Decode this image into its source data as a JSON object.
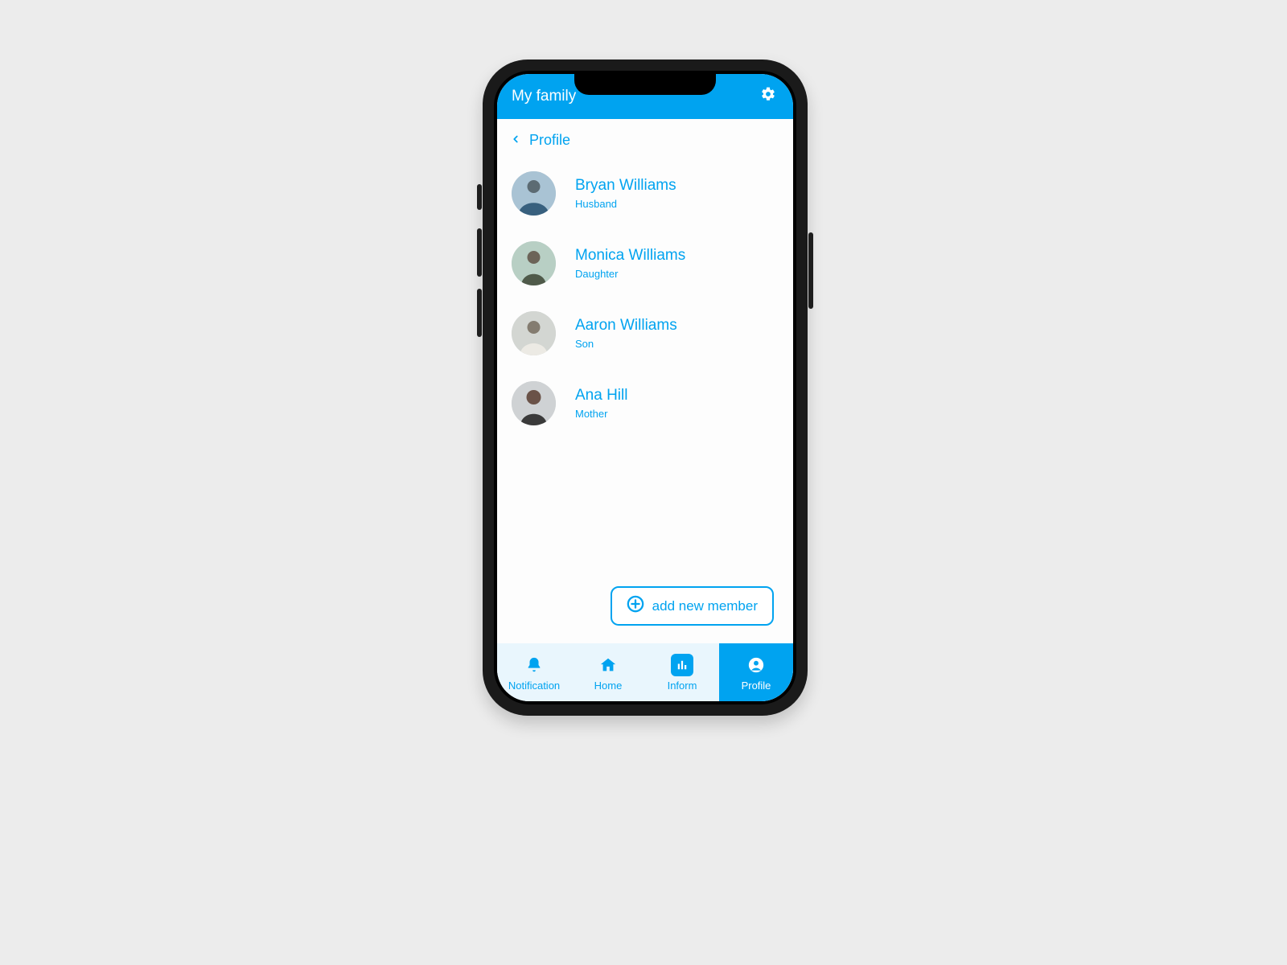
{
  "header": {
    "title": "My family",
    "settings_icon": "gear"
  },
  "breadcrumb": {
    "back_icon": "chevron-left",
    "label": "Profile"
  },
  "members": [
    {
      "name": "Bryan Williams",
      "relation": "Husband"
    },
    {
      "name": "Monica Williams",
      "relation": "Daughter"
    },
    {
      "name": "Aaron Williams",
      "relation": "Son"
    },
    {
      "name": "Ana Hill",
      "relation": "Mother"
    }
  ],
  "actions": {
    "add_label": "add new member",
    "add_icon": "plus-circle"
  },
  "nav": {
    "items": [
      {
        "label": "Notification",
        "icon": "bell",
        "active": false
      },
      {
        "label": "Home",
        "icon": "home",
        "active": false
      },
      {
        "label": "Inform",
        "icon": "chart",
        "active": false
      },
      {
        "label": "Profile",
        "icon": "person",
        "active": true
      }
    ]
  },
  "colors": {
    "primary": "#00a3f0",
    "nav_bg": "#e9f6fd"
  }
}
